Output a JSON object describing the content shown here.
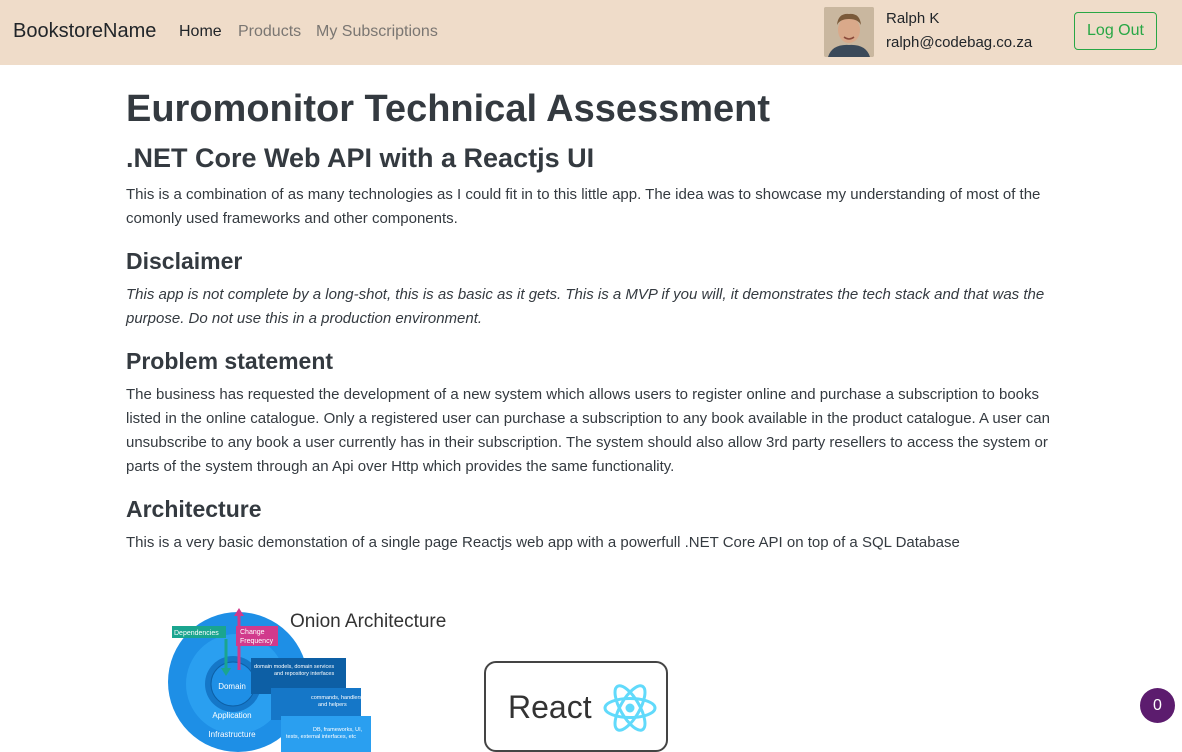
{
  "nav": {
    "brand": "BookstoreName",
    "links": [
      {
        "label": "Home",
        "active": true
      },
      {
        "label": "Products",
        "active": false
      },
      {
        "label": "My Subscriptions",
        "active": false
      }
    ],
    "user": {
      "name": "Ralph K",
      "email": "ralph@codebag.co.za"
    },
    "logout_label": "Log Out"
  },
  "main": {
    "title": "Euromonitor Technical Assessment",
    "subtitle": ".NET Core Web API with a Reactjs UI",
    "intro": "This is a combination of as many technologies as I could fit in to this little app. The idea was to showcase my understanding of most of the comonly used frameworks and other components.",
    "sections": [
      {
        "heading": "Disclaimer",
        "text": "This app is not complete by a long-shot, this is as basic as it gets. This is a MVP if you will, it demonstrates the tech stack and that was the purpose. Do not use this in a production environment."
      },
      {
        "heading": "Problem statement",
        "text": "The business has requested the development of a new system which allows users to register online and purchase a subscription to books listed in the online catalogue. Only a registered user can purchase a subscription to any book available in the product catalogue. A user can unsubscribe to any book a user currently has in their subscription. The system should also allow 3rd party resellers to access the system or parts of the system through an Api over Http which provides the same functionality."
      },
      {
        "heading": "Architecture",
        "text": "This is a very basic demonstation of a single page Reactjs web app with a powerfull .NET Core API on top of a SQL Database"
      }
    ]
  },
  "diagrams": {
    "onion": {
      "title": "Onion Architecture",
      "tag_dependencies": "Dependencies",
      "tag_change": "Change",
      "tag_frequency": "Frequency",
      "layer_domain": "Domain",
      "layer_application": "Application",
      "layer_infrastructure": "Infrastructure",
      "callout1_a": "domain models, domain services",
      "callout1_b": "and repository interfaces",
      "callout2_a": "commands, handlers",
      "callout2_b": "and helpers",
      "callout3_a": "DB, frameworks, UI,",
      "callout3_b": "tests, external interfaces, etc"
    },
    "react": {
      "label": "React"
    }
  },
  "cart_badge": {
    "count": "0"
  },
  "colors": {
    "navbar_bg": "#efdcc9",
    "logout_green": "#28a745",
    "badge_purple": "#5c1c6e",
    "react_cyan": "#61dafb"
  }
}
